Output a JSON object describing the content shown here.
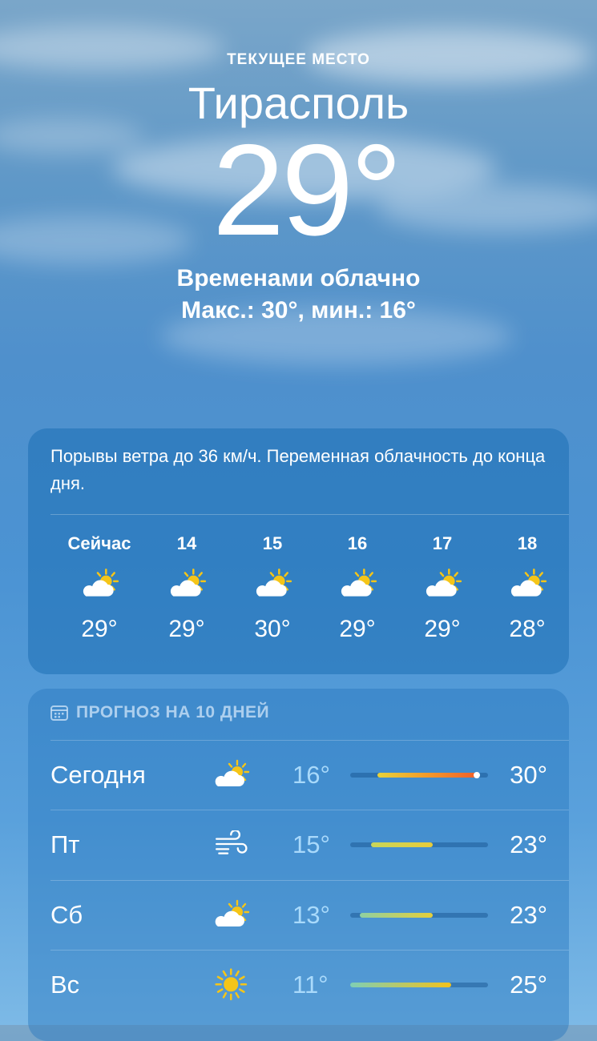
{
  "header": {
    "location_label": "ТЕКУЩЕЕ МЕСТО",
    "city": "Тирасполь",
    "temperature": "29°",
    "condition": "Временами облачно",
    "high_low": "Макс.: 30°, мин.: 16°"
  },
  "hourly": {
    "summary": "Порывы ветра до 36 км/ч. Переменная облачность до конца дня.",
    "items": [
      {
        "label": "Сейчас",
        "icon": "partly-sunny-icon",
        "temp": "29°"
      },
      {
        "label": "14",
        "icon": "partly-sunny-icon",
        "temp": "29°"
      },
      {
        "label": "15",
        "icon": "partly-sunny-icon",
        "temp": "30°"
      },
      {
        "label": "16",
        "icon": "partly-sunny-icon",
        "temp": "29°"
      },
      {
        "label": "17",
        "icon": "partly-sunny-icon",
        "temp": "29°"
      },
      {
        "label": "18",
        "icon": "partly-sunny-icon",
        "temp": "28°"
      }
    ]
  },
  "daily": {
    "title": "ПРОГНОЗ НА 10 ДНЕЙ",
    "title_icon": "calendar-icon",
    "items": [
      {
        "day": "Сегодня",
        "icon": "partly-sunny-icon",
        "low": "16°",
        "high": "30°",
        "range_start": 0.2,
        "range_end": 0.92,
        "current_marker": 0.92,
        "gradient": [
          "#e8d23a",
          "#f29a2a",
          "#f0602a"
        ]
      },
      {
        "day": "Пт",
        "icon": "wind-icon",
        "low": "15°",
        "high": "23°",
        "range_start": 0.15,
        "range_end": 0.6,
        "gradient": [
          "#c8d65a",
          "#e8cc3a"
        ]
      },
      {
        "day": "Сб",
        "icon": "partly-sunny-icon",
        "low": "13°",
        "high": "23°",
        "range_start": 0.07,
        "range_end": 0.6,
        "gradient": [
          "#8fd0a2",
          "#e6cf3a"
        ]
      },
      {
        "day": "Вс",
        "icon": "sun-icon",
        "low": "11°",
        "high": "25°",
        "range_start": 0.0,
        "range_end": 0.73,
        "gradient": [
          "#7fcfb5",
          "#f2c21c"
        ]
      }
    ]
  },
  "colors": {
    "background_top": "#7aa6c9",
    "background_bottom": "#7cb9e6",
    "low_temp": "#b4e1ff",
    "sun": "#f5c518"
  }
}
